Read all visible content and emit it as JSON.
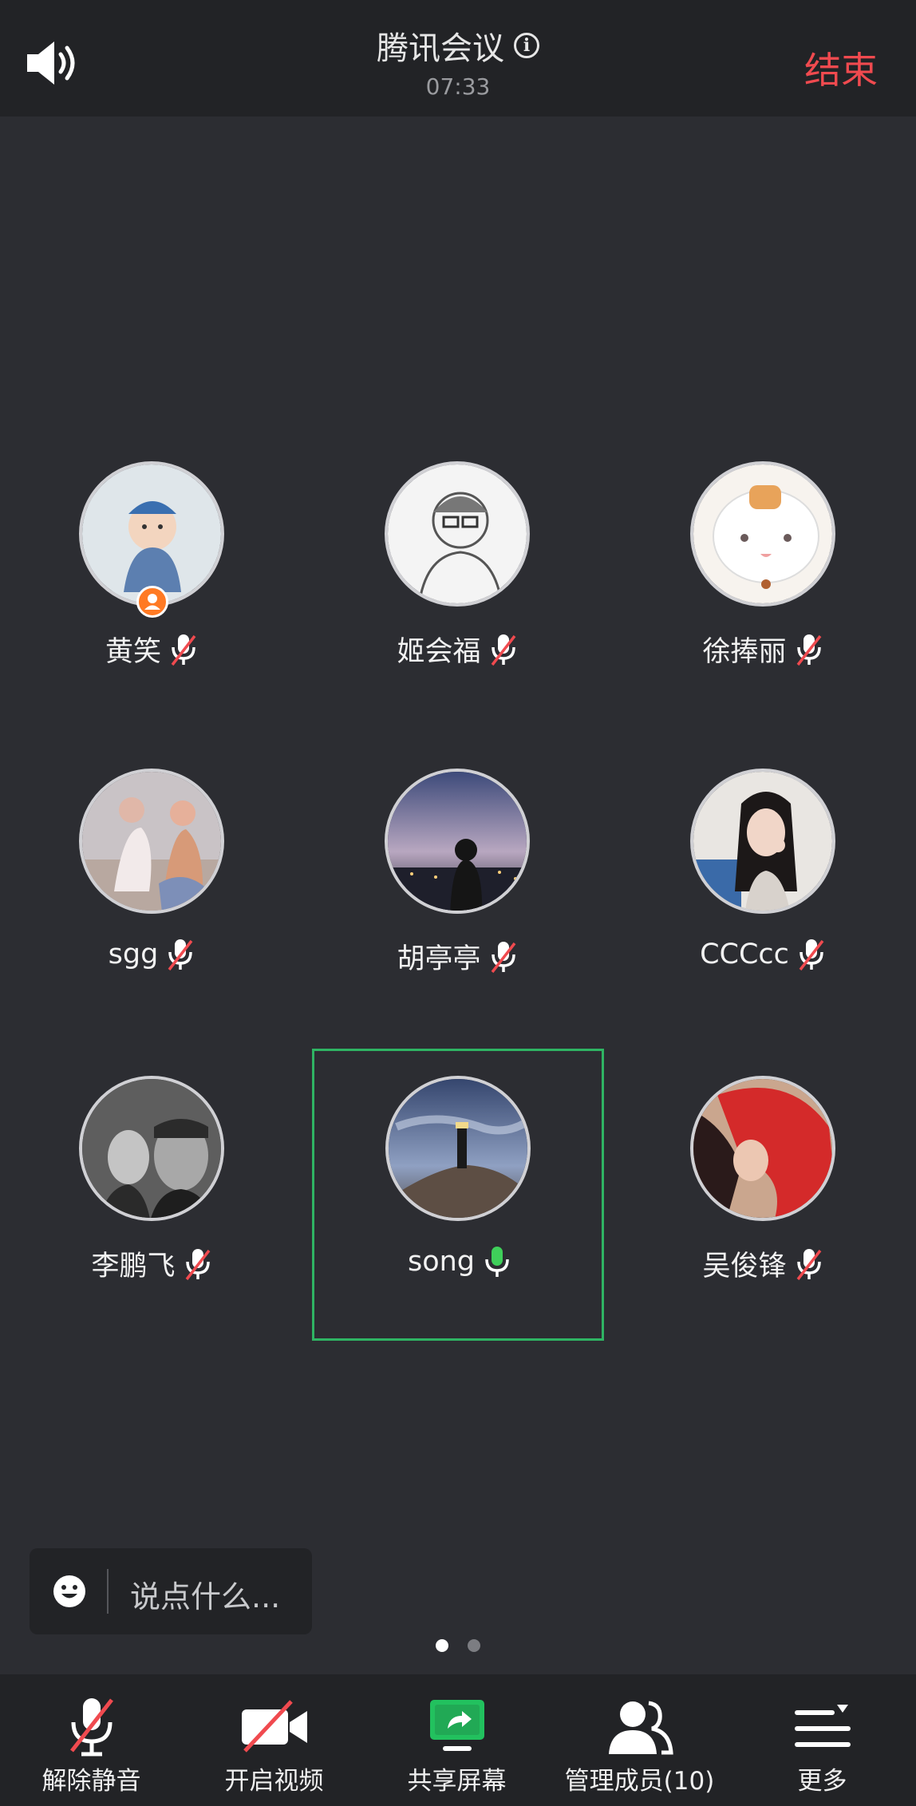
{
  "header": {
    "title": "腾讯会议",
    "time": "07:33",
    "end_label": "结束"
  },
  "participants": [
    {
      "name": "黄笑",
      "mic": "muted",
      "host": true
    },
    {
      "name": "姬会福",
      "mic": "muted"
    },
    {
      "name": "徐捧丽",
      "mic": "muted"
    },
    {
      "name": "sgg",
      "mic": "muted"
    },
    {
      "name": "胡亭亭",
      "mic": "muted"
    },
    {
      "name": "CCCcc",
      "mic": "muted"
    },
    {
      "name": "李鹏飞",
      "mic": "muted"
    },
    {
      "name": "song",
      "mic": "active",
      "selected": true
    },
    {
      "name": "吴俊锋",
      "mic": "muted"
    }
  ],
  "chat": {
    "placeholder": "说点什么..."
  },
  "pager": {
    "current": 1,
    "total": 2
  },
  "toolbar": {
    "unmute": "解除静音",
    "video": "开启视频",
    "share": "共享屏幕",
    "members": "管理成员(10)",
    "more": "更多"
  },
  "colors": {
    "end": "#f04a4f",
    "active_mic": "#3fcf5a",
    "selected_border": "#2fb463",
    "share_icon": "#22c15e",
    "host_badge": "#ff7a24"
  }
}
